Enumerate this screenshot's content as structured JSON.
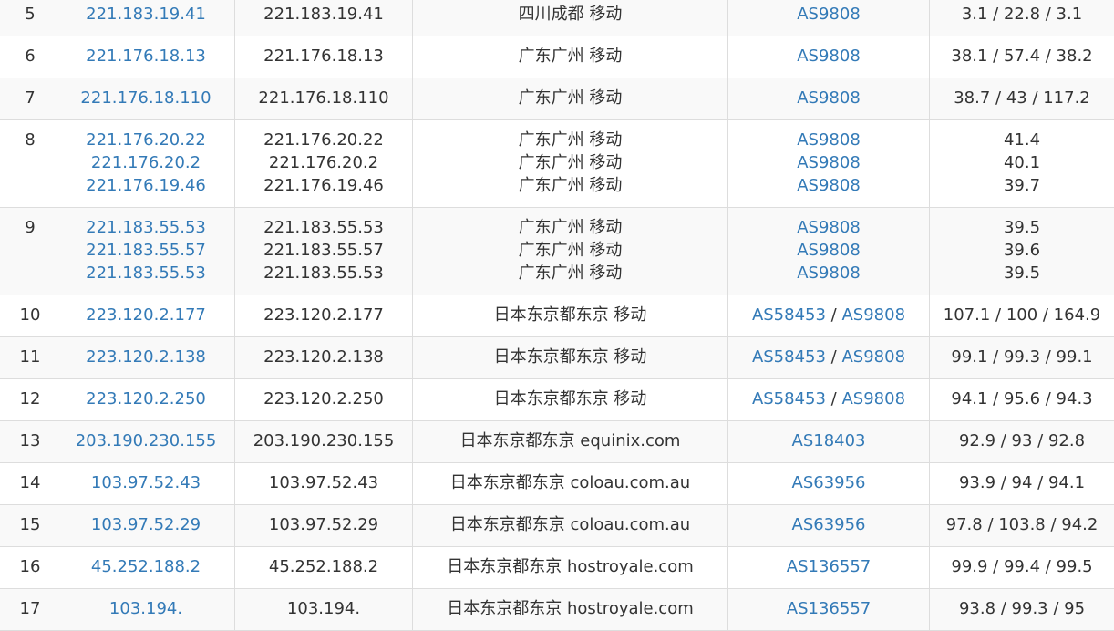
{
  "rows": [
    {
      "hop": "5",
      "lines": [
        {
          "ip": "221.183.19.41",
          "host": "221.183.19.41",
          "loc": "四川成都 移动",
          "asn": [
            "AS9808"
          ],
          "rtt": "3.1 / 22.8 / 3.1"
        }
      ]
    },
    {
      "hop": "6",
      "lines": [
        {
          "ip": "221.176.18.13",
          "host": "221.176.18.13",
          "loc": "广东广州 移动",
          "asn": [
            "AS9808"
          ],
          "rtt": "38.1 / 57.4 / 38.2"
        }
      ]
    },
    {
      "hop": "7",
      "lines": [
        {
          "ip": "221.176.18.110",
          "host": "221.176.18.110",
          "loc": "广东广州 移动",
          "asn": [
            "AS9808"
          ],
          "rtt": "38.7 / 43 / 117.2"
        }
      ]
    },
    {
      "hop": "8",
      "lines": [
        {
          "ip": "221.176.20.22",
          "host": "221.176.20.22",
          "loc": "广东广州 移动",
          "asn": [
            "AS9808"
          ],
          "rtt": "41.4"
        },
        {
          "ip": "221.176.20.2",
          "host": "221.176.20.2",
          "loc": "广东广州 移动",
          "asn": [
            "AS9808"
          ],
          "rtt": "40.1"
        },
        {
          "ip": "221.176.19.46",
          "host": "221.176.19.46",
          "loc": "广东广州 移动",
          "asn": [
            "AS9808"
          ],
          "rtt": "39.7"
        }
      ]
    },
    {
      "hop": "9",
      "lines": [
        {
          "ip": "221.183.55.53",
          "host": "221.183.55.53",
          "loc": "广东广州 移动",
          "asn": [
            "AS9808"
          ],
          "rtt": "39.5"
        },
        {
          "ip": "221.183.55.57",
          "host": "221.183.55.57",
          "loc": "广东广州 移动",
          "asn": [
            "AS9808"
          ],
          "rtt": "39.6"
        },
        {
          "ip": "221.183.55.53",
          "host": "221.183.55.53",
          "loc": "广东广州 移动",
          "asn": [
            "AS9808"
          ],
          "rtt": "39.5"
        }
      ]
    },
    {
      "hop": "10",
      "lines": [
        {
          "ip": "223.120.2.177",
          "host": "223.120.2.177",
          "loc": "日本东京都东京 移动",
          "asn": [
            "AS58453",
            "AS9808"
          ],
          "rtt": "107.1 / 100 / 164.9"
        }
      ]
    },
    {
      "hop": "11",
      "lines": [
        {
          "ip": "223.120.2.138",
          "host": "223.120.2.138",
          "loc": "日本东京都东京 移动",
          "asn": [
            "AS58453",
            "AS9808"
          ],
          "rtt": "99.1 / 99.3 / 99.1"
        }
      ]
    },
    {
      "hop": "12",
      "lines": [
        {
          "ip": "223.120.2.250",
          "host": "223.120.2.250",
          "loc": "日本东京都东京 移动",
          "asn": [
            "AS58453",
            "AS9808"
          ],
          "rtt": "94.1 / 95.6 / 94.3"
        }
      ]
    },
    {
      "hop": "13",
      "lines": [
        {
          "ip": "203.190.230.155",
          "host": "203.190.230.155",
          "loc": "日本东京都东京 equinix.com",
          "asn": [
            "AS18403"
          ],
          "rtt": "92.9 / 93 / 92.8"
        }
      ]
    },
    {
      "hop": "14",
      "lines": [
        {
          "ip": "103.97.52.43",
          "host": "103.97.52.43",
          "loc": "日本东京都东京 coloau.com.au",
          "asn": [
            "AS63956"
          ],
          "rtt": "93.9 / 94 / 94.1"
        }
      ]
    },
    {
      "hop": "15",
      "lines": [
        {
          "ip": "103.97.52.29",
          "host": "103.97.52.29",
          "loc": "日本东京都东京 coloau.com.au",
          "asn": [
            "AS63956"
          ],
          "rtt": "97.8 / 103.8 / 94.2"
        }
      ]
    },
    {
      "hop": "16",
      "lines": [
        {
          "ip": "45.252.188.2",
          "host": "45.252.188.2",
          "loc": "日本东京都东京 hostroyale.com",
          "asn": [
            "AS136557"
          ],
          "rtt": "99.9 / 99.4 / 99.5"
        }
      ]
    },
    {
      "hop": "17",
      "lines": [
        {
          "ip": "103.194.",
          "host": "103.194.",
          "loc": "日本东京都东京 hostroyale.com",
          "asn": [
            "AS136557"
          ],
          "rtt": "93.8 / 99.3 / 95",
          "redacted": true
        }
      ]
    }
  ],
  "asn_separator": "/",
  "colors": {
    "link": "#337ab7",
    "text": "#333333",
    "border": "#dddddd",
    "stripe": "#f9f9f9"
  }
}
